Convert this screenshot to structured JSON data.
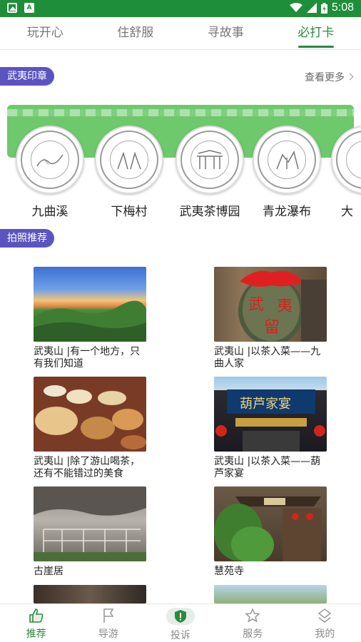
{
  "status_bar": {
    "time": "5:08"
  },
  "tabs": [
    {
      "label": "玩开心"
    },
    {
      "label": "住舒服"
    },
    {
      "label": "寻故事"
    },
    {
      "label": "必打卡"
    }
  ],
  "stamps_section": {
    "title": "武夷印章",
    "more_label": "查看更多",
    "items": [
      {
        "name": "九曲溪"
      },
      {
        "name": "下梅村"
      },
      {
        "name": "武夷茶博园"
      },
      {
        "name": "青龙瀑布"
      },
      {
        "name": "大"
      }
    ]
  },
  "photo_section": {
    "title": "拍照推荐",
    "cards": [
      {
        "caption": "武夷山 |有一个地方，只有我们知道"
      },
      {
        "caption": "武夷山 |以茶入菜——九曲人家"
      },
      {
        "caption": "武夷山 |除了游山喝茶，还有不能错过的美食"
      },
      {
        "caption": "武夷山 |以茶入菜——葫芦家宴"
      },
      {
        "caption": "古崖居"
      },
      {
        "caption": "慧苑寺"
      }
    ]
  },
  "bottom_nav": [
    {
      "label": "推荐",
      "icon": "thumbs-up-icon"
    },
    {
      "label": "导游",
      "icon": "flag-icon"
    },
    {
      "label": "投诉",
      "icon": "shield-alert-icon"
    },
    {
      "label": "服务",
      "icon": "star-icon"
    },
    {
      "label": "我的",
      "icon": "user-icon"
    }
  ],
  "colors": {
    "status_bar": "#1f8e3a",
    "accent_green": "#2a8a3e",
    "badge_purple": "#5b54c0",
    "stamp_band": "#6ec96c"
  }
}
